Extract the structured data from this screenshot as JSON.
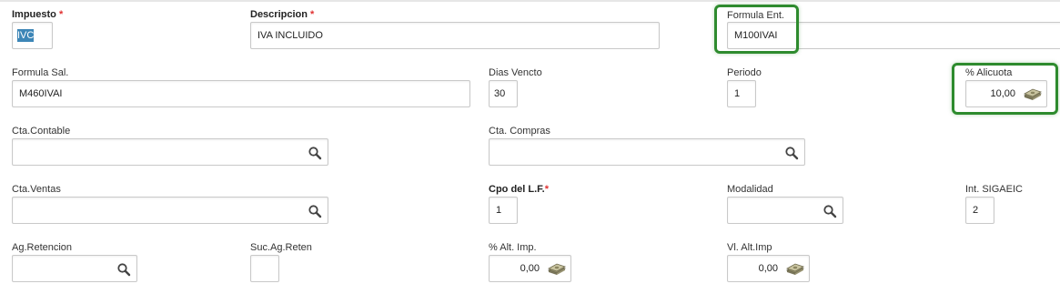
{
  "form": {
    "impuesto": {
      "label": "Impuesto",
      "required": "*",
      "value": "IVC"
    },
    "descripcion": {
      "label": "Descripcion",
      "required": "*",
      "value": "IVA INCLUIDO"
    },
    "formula_ent": {
      "label": "Formula Ent.",
      "value": "M100IVAI"
    },
    "formula_sal": {
      "label": "Formula Sal.",
      "value": "M460IVAI"
    },
    "dias_vencto": {
      "label": "Dias Vencto",
      "value": "30"
    },
    "periodo": {
      "label": "Periodo",
      "value": "1"
    },
    "alicuota": {
      "label": "% Alicuota",
      "value": "10,00"
    },
    "cta_contable": {
      "label": "Cta.Contable",
      "value": ""
    },
    "cta_compras": {
      "label": "Cta. Compras",
      "value": ""
    },
    "cta_ventas": {
      "label": "Cta.Ventas",
      "value": ""
    },
    "cpo_lf": {
      "label": "Cpo del L.F.",
      "required": "*",
      "value": "1"
    },
    "modalidad": {
      "label": "Modalidad",
      "value": ""
    },
    "int_sigaeic": {
      "label": "Int. SIGAEIC",
      "value": "2"
    },
    "ag_retencion": {
      "label": "Ag.Retencion",
      "value": ""
    },
    "suc_ag_reten": {
      "label": "Suc.Ag.Reten",
      "value": ""
    },
    "alt_imp": {
      "label": "% Alt. Imp.",
      "value": "0,00"
    },
    "vl_alt_imp": {
      "label": "Vl. Alt.Imp",
      "value": "0,00"
    }
  },
  "icons": {
    "lookup": "search-icon",
    "calculator": "money-icon"
  },
  "colors": {
    "highlight": "#2e8b2e",
    "required": "#e03131",
    "selection": "#3d86b7"
  }
}
